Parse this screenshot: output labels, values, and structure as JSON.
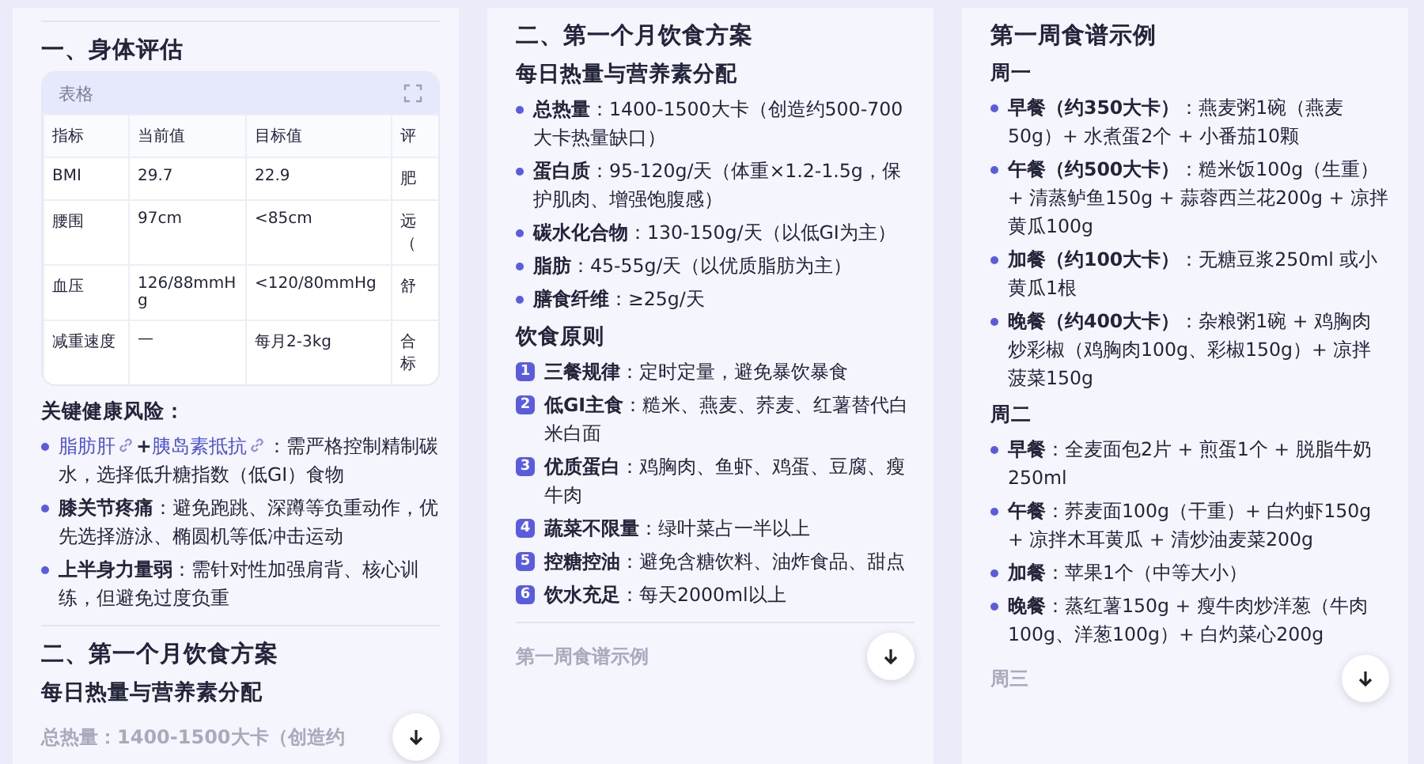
{
  "panels": [
    {
      "blocks": [
        {
          "kind": "divider"
        },
        {
          "kind": "h2",
          "text": "一、身体评估"
        },
        {
          "kind": "table",
          "label": "表格",
          "columns": [
            "指标",
            "当前值",
            "目标值",
            "评"
          ],
          "rows": [
            [
              "BMI",
              "29.7",
              "22.9",
              "肥"
            ],
            [
              "腰围",
              "97cm",
              "<85cm",
              "远（"
            ],
            [
              "血压",
              "126/88mmHg",
              "<120/80mmHg",
              "舒"
            ],
            [
              "减重速度",
              "—",
              "每月2-3kg",
              "合标"
            ]
          ]
        },
        {
          "kind": "h4",
          "text": "关键健康风险："
        },
        {
          "kind": "bullets",
          "items": [
            {
              "kind": "links",
              "links": [
                "脂肪肝",
                "胰岛素抵抗"
              ],
              "joiner": "+",
              "detail": "：需严格控制精制碳水，选择低升糖指数（低GI）食物"
            },
            {
              "kind": "plain",
              "term": "膝关节疼痛",
              "detail": "：避免跑跳、深蹲等负重动作，优先选择游泳、椭圆机等低冲击运动"
            },
            {
              "kind": "plain",
              "term": "上半身力量弱",
              "detail": "：需针对性加强肩背、核心训练，但避免过度负重"
            }
          ]
        },
        {
          "kind": "divider"
        },
        {
          "kind": "h2",
          "text": "二、第一个月饮食方案"
        },
        {
          "kind": "h3",
          "text": "每日热量与营养素分配"
        },
        {
          "kind": "faded",
          "text": "总热量：1400-1500大卡（创造约"
        }
      ]
    },
    {
      "blocks": [
        {
          "kind": "h2",
          "text": "二、第一个月饮食方案"
        },
        {
          "kind": "h3",
          "text": "每日热量与营养素分配"
        },
        {
          "kind": "bullets",
          "items": [
            {
              "kind": "plain",
              "term": "总热量",
              "detail": "：1400-1500大卡（创造约500-700大卡热量缺口）"
            },
            {
              "kind": "plain",
              "term": "蛋白质",
              "detail": "：95-120g/天（体重×1.2-1.5g，保护肌肉、增强饱腹感）"
            },
            {
              "kind": "plain",
              "term": "碳水化合物",
              "detail": "：130-150g/天（以低GI为主）"
            },
            {
              "kind": "plain",
              "term": "脂肪",
              "detail": "：45-55g/天（以优质脂肪为主）"
            },
            {
              "kind": "plain",
              "term": "膳食纤维",
              "detail": "：≥25g/天"
            }
          ]
        },
        {
          "kind": "h3",
          "text": "饮食原则"
        },
        {
          "kind": "numbered",
          "items": [
            {
              "num": "1",
              "term": "三餐规律",
              "detail": "：定时定量，避免暴饮暴食"
            },
            {
              "num": "2",
              "term": "低GI主食",
              "detail": "：糙米、燕麦、荞麦、红薯替代白米白面"
            },
            {
              "num": "3",
              "term": "优质蛋白",
              "detail": "：鸡胸肉、鱼虾、鸡蛋、豆腐、瘦牛肉"
            },
            {
              "num": "4",
              "term": "蔬菜不限量",
              "detail": "：绿叶菜占一半以上"
            },
            {
              "num": "5",
              "term": "控糖控油",
              "detail": "：避免含糖饮料、油炸食品、甜点"
            },
            {
              "num": "6",
              "term": "饮水充足",
              "detail": "：每天2000ml以上"
            }
          ]
        },
        {
          "kind": "divider"
        },
        {
          "kind": "faded",
          "text": "第一周食谱示例"
        }
      ]
    },
    {
      "blocks": [
        {
          "kind": "h2",
          "text": "第一周食谱示例"
        },
        {
          "kind": "h4",
          "text": "周一"
        },
        {
          "kind": "bullets",
          "items": [
            {
              "kind": "plain",
              "term": "早餐（约350大卡）",
              "detail": "：燕麦粥1碗（燕麦50g）+ 水煮蛋2个 + 小番茄10颗"
            },
            {
              "kind": "plain",
              "term": "午餐（约500大卡）",
              "detail": "：糙米饭100g（生重）+ 清蒸鲈鱼150g + 蒜蓉西兰花200g + 凉拌黄瓜100g"
            },
            {
              "kind": "plain",
              "term": "加餐（约100大卡）",
              "detail": "：无糖豆浆250ml 或小黄瓜1根"
            },
            {
              "kind": "plain",
              "term": "晚餐（约400大卡）",
              "detail": "：杂粮粥1碗 + 鸡胸肉炒彩椒（鸡胸肉100g、彩椒150g）+ 凉拌菠菜150g"
            }
          ]
        },
        {
          "kind": "h4",
          "text": "周二"
        },
        {
          "kind": "bullets",
          "items": [
            {
              "kind": "plain",
              "term": "早餐",
              "detail": "：全麦面包2片 + 煎蛋1个 + 脱脂牛奶250ml"
            },
            {
              "kind": "plain",
              "term": "午餐",
              "detail": "：荞麦面100g（干重）+ 白灼虾150g + 凉拌木耳黄瓜 + 清炒油麦菜200g"
            },
            {
              "kind": "plain",
              "term": "加餐",
              "detail": "：苹果1个（中等大小）"
            },
            {
              "kind": "plain",
              "term": "晚餐",
              "detail": "：蒸红薯150g + 瘦牛肉炒洋葱（牛肉100g、洋葱100g）+ 白灼菜心200g"
            }
          ]
        },
        {
          "kind": "faded",
          "text": "周三"
        }
      ]
    }
  ]
}
